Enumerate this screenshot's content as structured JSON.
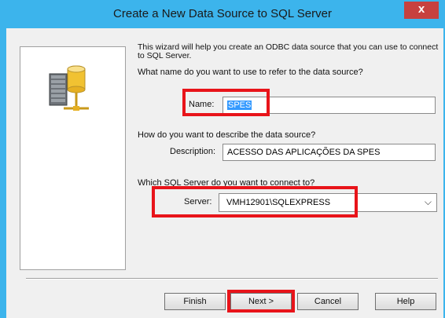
{
  "window": {
    "title": "Create a New Data Source to SQL Server",
    "close_label": "x"
  },
  "wizard": {
    "intro": "This wizard will help you create an ODBC data source that you can use to connect to SQL Server.",
    "name_question": "What name do you want to use to refer to the data source?",
    "name_label": "Name:",
    "name_value": "SPES",
    "description_question": "How do you want to describe the data source?",
    "description_label": "Description:",
    "description_value": "ACESSO DAS APLICAÇÕES DA SPES",
    "server_question": "Which SQL Server do you want to connect to?",
    "server_label": "Server:",
    "server_value": "VMH12901\\SQLEXPRESS"
  },
  "buttons": {
    "finish": "Finish",
    "next": "Next >",
    "cancel": "Cancel",
    "help": "Help"
  },
  "colors": {
    "title_bar": "#3cb4ec",
    "highlight": "#e8141a",
    "selection": "#3399ff"
  },
  "icons": {
    "wizard_graphic": "database-server-icon"
  }
}
